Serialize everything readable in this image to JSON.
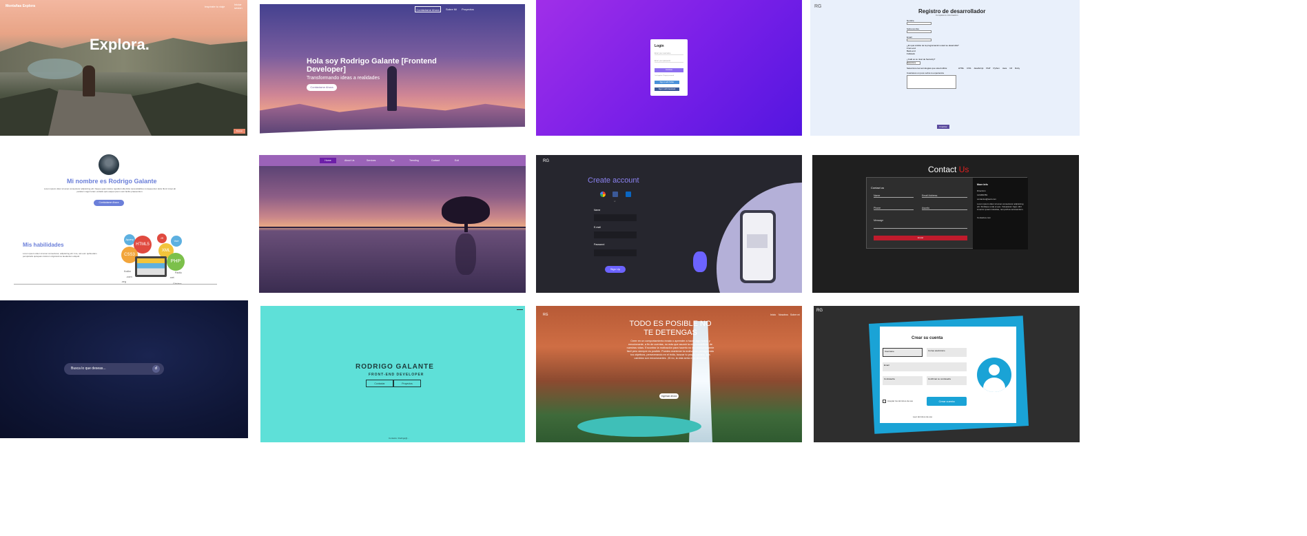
{
  "t1": {
    "brand": "Montañas Explora",
    "nav_link": "Inspírate tu viaje",
    "nav_user": "Iniciar sesión",
    "title": "Explora.",
    "corner_btn": "Buscar"
  },
  "t2": {
    "nav": [
      "Contáctame Ahora",
      "Sobre Mí",
      "Proyectos"
    ],
    "title": "Hola soy Rodrigo Galante [Frontend Developer]",
    "subtitle": "Transformando ideas a realidades",
    "cta": "Contáctame Ahora"
  },
  "t3": {
    "title": "Login",
    "user_placeholder": "Enter your username",
    "pass_placeholder": "Enter your password",
    "continue": "Continue",
    "forgot": "I've forgotten / Forgot password",
    "google": "Sign in with Twitter",
    "facebook": "Sign in with Facebook"
  },
  "t4": {
    "logo": "RG",
    "title": "Registro de desarrollador",
    "subtitle": "Completa tu información",
    "f_name": "Nombre",
    "f_last": "Sobrenombre",
    "f_email": "Email",
    "q_area": "¿En qué ámbito de la programación usted se desarrolla?",
    "areas": [
      "Front-end",
      "Back-end",
      "Fullstack"
    ],
    "q_level": "¿Cuál es su nivel de Seniority?",
    "level_value": "Seleccione",
    "q_tech": "Seleccione las tecnologías que usted utiliza:",
    "techs": [
      "HTML",
      "CSS",
      "JavaScript",
      "PHP",
      "Python",
      "Java",
      "C#",
      "Ruby"
    ],
    "q_about": "Cuéntanos un poco sobre tu experiencia",
    "submit": "Finalizar"
  },
  "t5": {
    "name": "Mi nombre es Rodrigo Galante",
    "bio": "Lorem ipsum dolor sit amet consectetur adipisicing elit. Neque quam dolore repellat nulla dicta necessitatibus consequuntur dolor illum! Amet ab pariatur magni totam veritatis quis eaque ipsum sunt facilis praesentium.",
    "cta": "Contáctame Ahora",
    "skills_title": "Mis habilidades",
    "skills_text": "Lorem ipsum dolor sit amet consectetur, adipisicing elit. Iure, aut eum quibusdam perspiciatis quisquam dolorum dignissimos laudantium aliquid.",
    "bubbles": [
      "Jquery",
      "HTML5",
      "JS",
      "Vue",
      "CSS3",
      "XML",
      "PHP"
    ],
    "domains": [
      "Kodkn",
      ".com",
      ".net",
      ".org",
      "Paxtlo",
      "Ghidara"
    ]
  },
  "t6": {
    "nav": [
      "Home",
      "About Us",
      "Services",
      "Tips",
      "Trending",
      "Contact",
      "Exit"
    ]
  },
  "t7": {
    "logo": "RG",
    "title": "Create account",
    "or": "or",
    "name": "Name",
    "email": "E-mail",
    "password": "Password",
    "submit": "Sign Up"
  },
  "t8": {
    "title_a": "Contact",
    "title_b": "Us",
    "form_title": "Contact us",
    "f_name": "Name",
    "f_email": "Email Address",
    "f_phone": "Phone",
    "f_subject": "Asunto",
    "f_message": "Message",
    "send": "Enviar",
    "info_title": "More Info",
    "info": [
      "Dirección",
      "123456789",
      "contactus@web.com"
    ],
    "info_text": "Lorem ipsum dolor sit amet consectetur adipisicing elit. Similique unde et quo. Voluptatum fugit, nihil inventor quasi molestiae, temporibus accusantium.",
    "info_link": "Contactus.com"
  },
  "t9": {
    "search_placeholder": "Busca lo que deseas..."
  },
  "t10": {
    "name": "RODRIGO GALANTE",
    "role": "FRONT-END DEVELOPER",
    "btn1": "Contactar",
    "btn2": "Proyectos",
    "footer": "Contacto: Rodrigo@..."
  },
  "t11": {
    "logo": "RG",
    "nav": [
      "Inicio",
      "Nosotros",
      "Sobre mi"
    ],
    "title": "TODO ES POSIBLE NO TE DETENGAS",
    "text": "Creer en un comportamiento innato o aprender a hacer algo nuevo y emocionante, a fin de cuentas, no más que asumir la responsabilidad de nuestras vidas. Encontrar la motivación para hacerlo no es necesariamente fácil pero siempre es posible. Puedes mantener la motivación persiguiendo tus objetivos, perseverando en el éxito, buscar tu propio camino. Los cambios son emocionantes. ¡Si no, la vida sería muy aburrida!",
    "cta": "Ingresar ahora"
  },
  "t12": {
    "logo": "RG",
    "title": "Crear su cuenta",
    "f_user": "Username",
    "f_mail": "Correo electrónico",
    "f_name": "Email",
    "f_pass": "Contraseña",
    "f_pass2": "Confirmar su contraseña",
    "terms": "Aceptar los términos de uso",
    "submit": "Crear cuenta",
    "link": "Leer términos de uso"
  }
}
